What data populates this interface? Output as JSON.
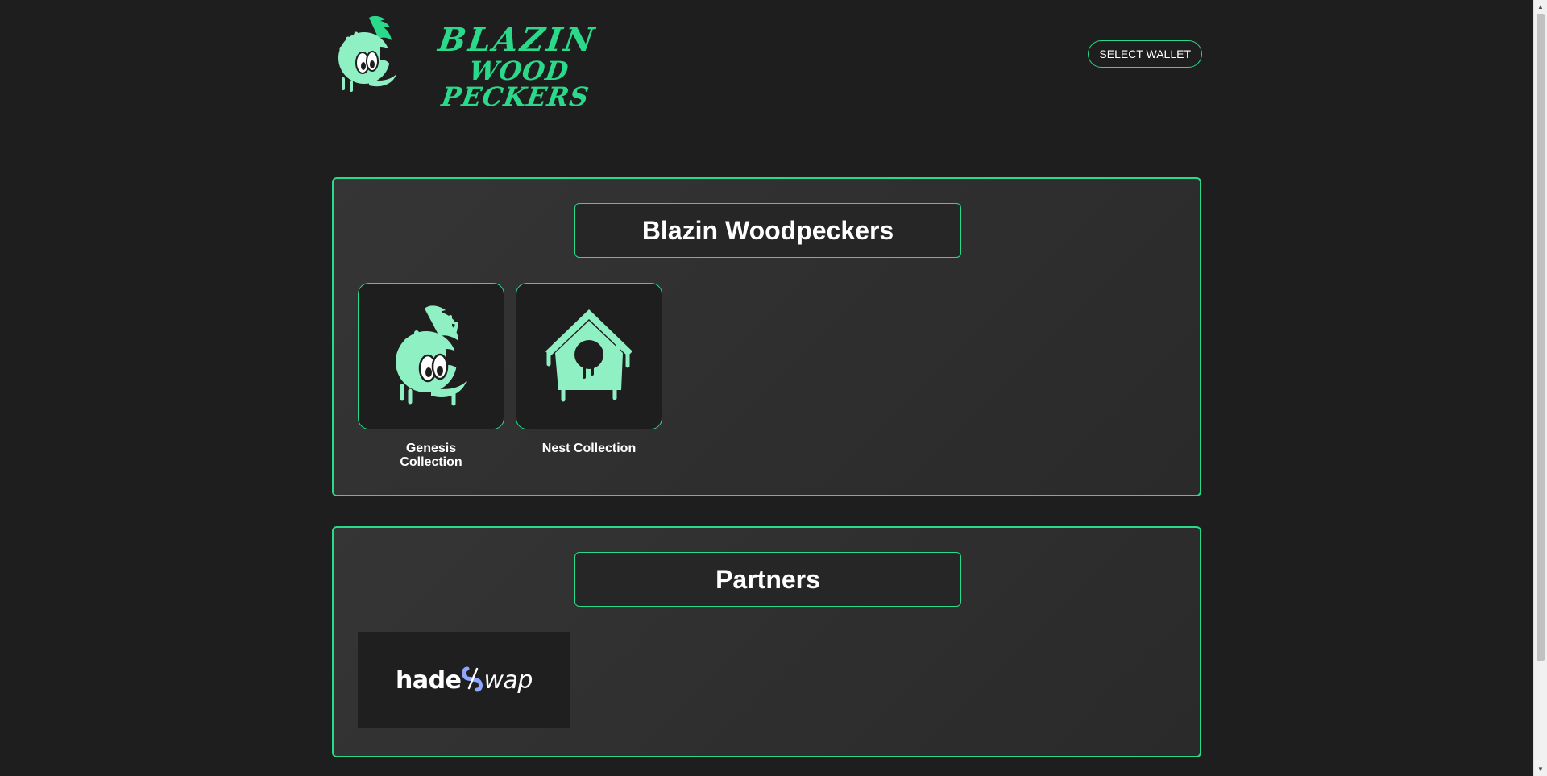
{
  "header": {
    "logo_line1": "BLAZIN",
    "logo_line2": "WOOD PECKERS",
    "wallet_button": "SELECT WALLET"
  },
  "collections": {
    "title": "Blazin Woodpeckers",
    "items": [
      {
        "label": "Genesis Collection",
        "icon": "woodpecker-icon"
      },
      {
        "label": "Nest Collection",
        "icon": "birdhouse-icon"
      }
    ]
  },
  "partners": {
    "title": "Partners",
    "items": [
      {
        "name": "hadeswap",
        "prefix": "hade",
        "suffix": "wap"
      }
    ]
  },
  "colors": {
    "background": "#1e1e1e",
    "accent": "#2bd98a",
    "icon_fill": "#8ff0c4",
    "panel": "#333333"
  }
}
